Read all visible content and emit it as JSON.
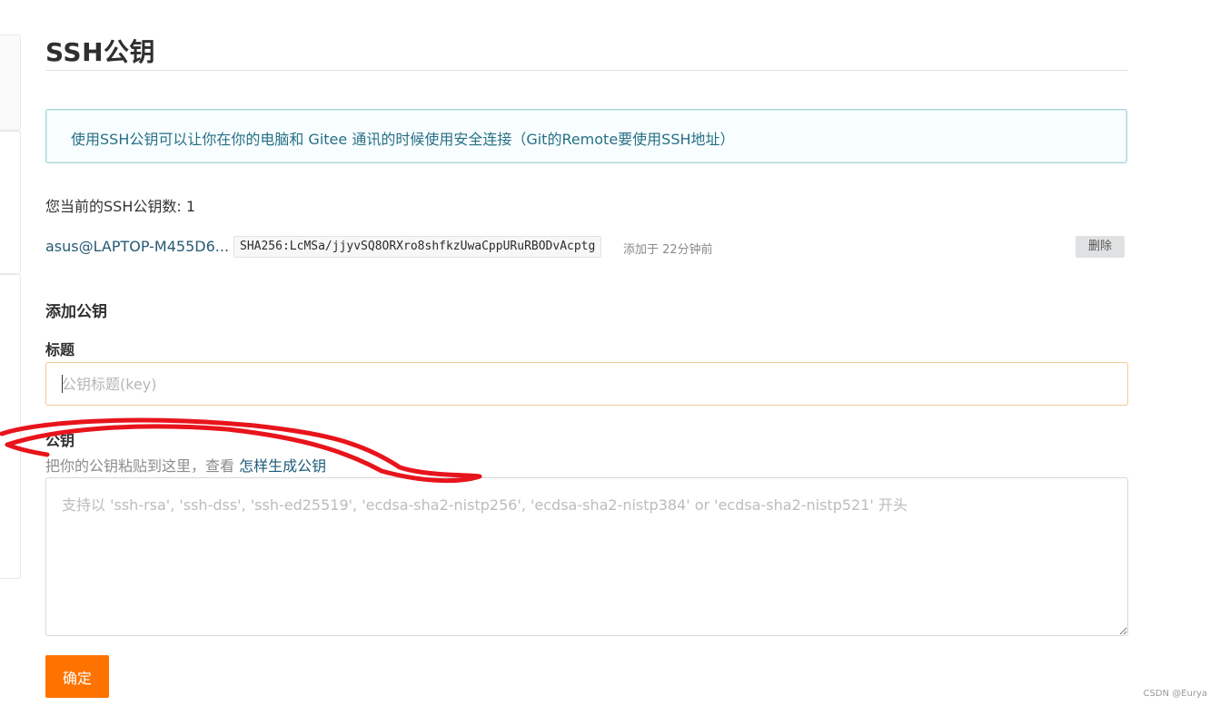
{
  "page": {
    "title": "SSH公钥"
  },
  "info_box": {
    "text": "使用SSH公钥可以让你在你的电脑和 Gitee 通讯的时候使用安全连接（Git的Remote要使用SSH地址）"
  },
  "keys": {
    "count_text": "您当前的SSH公钥数: 1",
    "items": [
      {
        "name": "asus@LAPTOP-M455D6...",
        "fingerprint": "SHA256:LcMSa/jjyvSQ8ORXro8shfkzUwaCppURuRBODvAcptg",
        "added": "添加于 22分钟前",
        "delete_label": "删除"
      }
    ]
  },
  "add_key": {
    "heading": "添加公钥",
    "title_label": "标题",
    "title_placeholder": "公钥标题(key)",
    "key_label": "公钥",
    "hint_prefix": "把你的公钥粘贴到这里，查看 ",
    "hint_link": "怎样生成公钥",
    "key_placeholder": "支持以 'ssh-rsa', 'ssh-dss', 'ssh-ed25519', 'ecdsa-sha2-nistp256', 'ecdsa-sha2-nistp384' or 'ecdsa-sha2-nistp521' 开头",
    "submit_label": "确定"
  },
  "annotation": {
    "color": "#e8141c"
  },
  "watermark": {
    "text": "CSDN @Eurya"
  },
  "colors": {
    "accent": "#fe7300",
    "link": "#1d5b7a",
    "info_border": "#a9d7dc"
  }
}
